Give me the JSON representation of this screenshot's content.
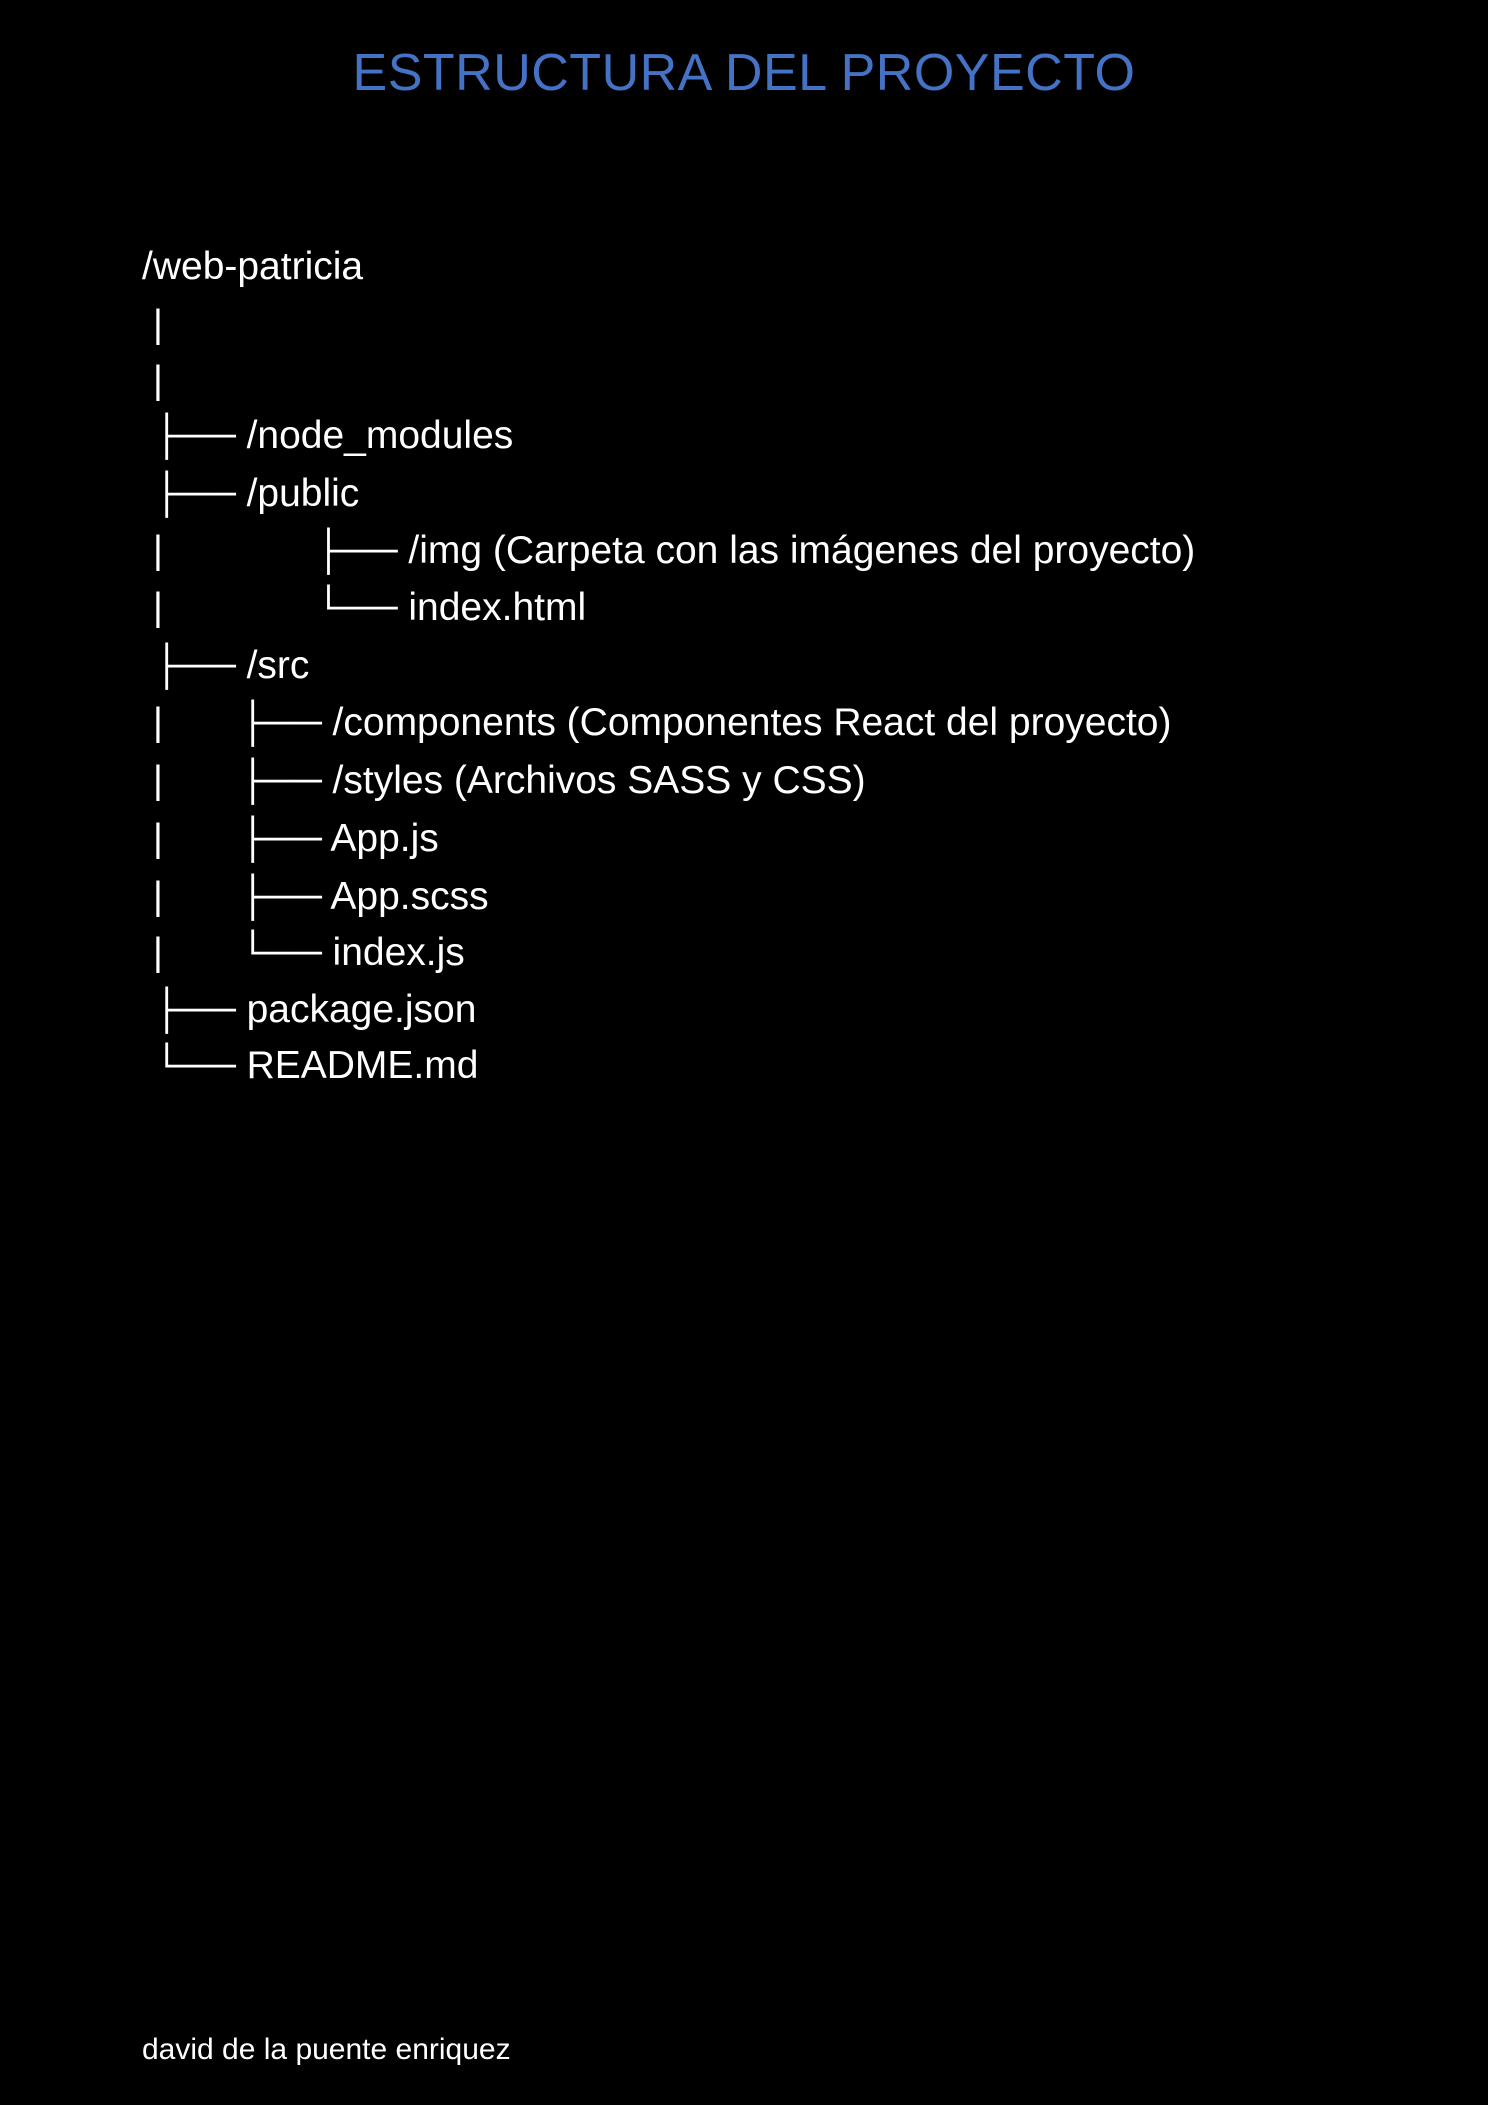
{
  "document": {
    "title": "ESTRUCTURA DEL PROYECTO",
    "title_color": "#4472C4",
    "text_color": "#FFFFFF",
    "background_color": "#000000",
    "tree_lines": [
      "/web-patricia",
      " |",
      " |",
      " ├── /node_modules",
      " ├── /public",
      " |              ├── /img (Carpeta con las imágenes del proyecto)",
      " |              └── index.html",
      " ├── /src",
      " |       ├── /components (Componentes React del proyecto)",
      " |       ├── /styles (Archivos SASS y CSS)",
      " |       ├── App.js",
      " |       ├── App.scss",
      " |       └── index.js",
      " ├── package.json",
      " └── README.md"
    ],
    "footer": "david de la puente enriquez"
  }
}
